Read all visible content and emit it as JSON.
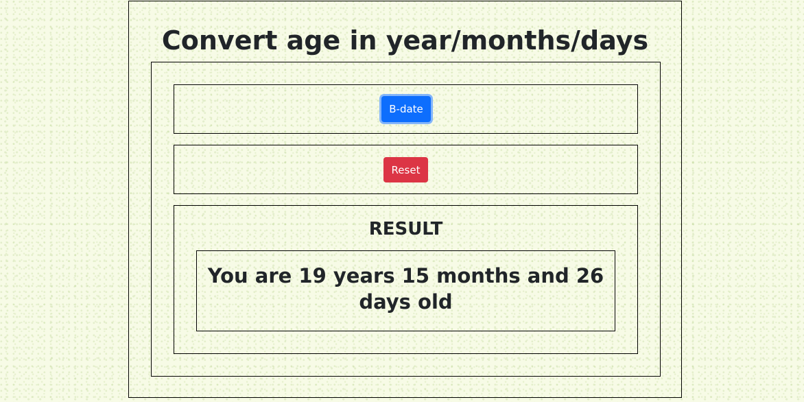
{
  "header": {
    "title": "Convert age in year/months/days"
  },
  "controls": {
    "bdate_label": "B-date",
    "reset_label": "Reset"
  },
  "result": {
    "heading": "RESULT",
    "text": "You are 19 years 15 months and 26 days old"
  },
  "colors": {
    "primary": "#0d6efd",
    "danger": "#dc3545",
    "text": "#212529",
    "background": "#f7fbe6"
  }
}
